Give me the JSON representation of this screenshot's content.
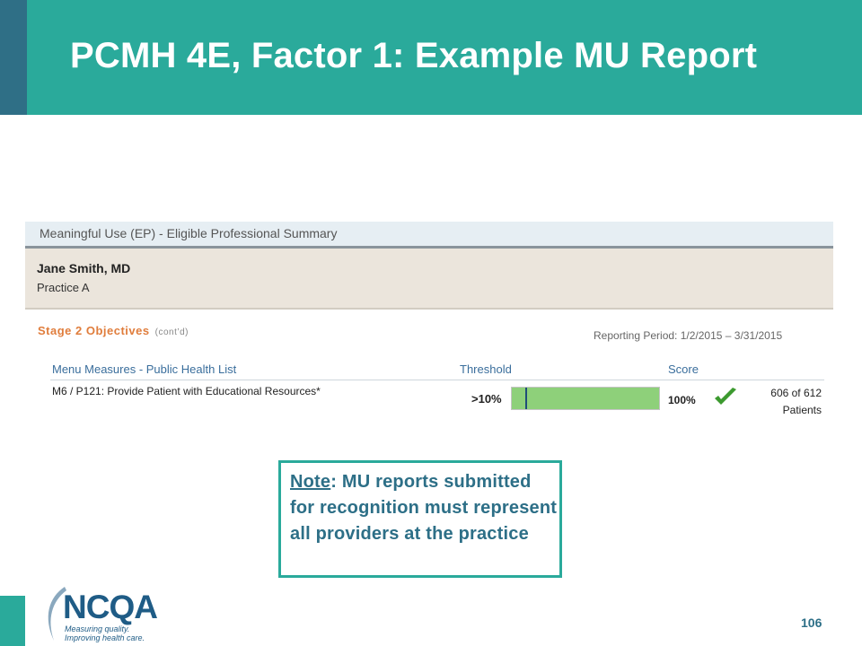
{
  "slide": {
    "title": "PCMH 4E, Factor 1: Example MU Report",
    "page_number": "106"
  },
  "report": {
    "title": "Meaningful Use (EP) - Eligible Professional Summary",
    "provider_name": "Jane Smith, MD",
    "practice": "Practice A",
    "stage_label": "Stage 2 Objectives",
    "stage_suffix": "(cont’d)",
    "reporting_period": "Reporting Period: 1/2/2015 – 3/31/2015",
    "columns": {
      "measure": "Menu Measures - Public Health List",
      "threshold": "Threshold",
      "score": "Score"
    },
    "rows": [
      {
        "measure": "M6 / P121: Provide Patient with Educational Resources*",
        "threshold": ">10%",
        "threshold_fraction": 0.1,
        "score": "100%",
        "score_fraction": 1.0,
        "count_line1": "606 of 612",
        "count_line2": "Patients",
        "status_icon": "check-icon",
        "status_color": "#3c9a2f"
      }
    ]
  },
  "note": {
    "label": "Note",
    "text": ": MU reports submitted for recognition must represent all providers at the practice"
  },
  "logo": {
    "text": "NCQA",
    "tagline_1": "Measuring quality.",
    "tagline_2": "Improving health care."
  },
  "colors": {
    "teal": "#2aaa9b",
    "dark_blue": "#2f6f86",
    "bar_fill": "#8ed07a",
    "stage_orange": "#e07d3c"
  }
}
